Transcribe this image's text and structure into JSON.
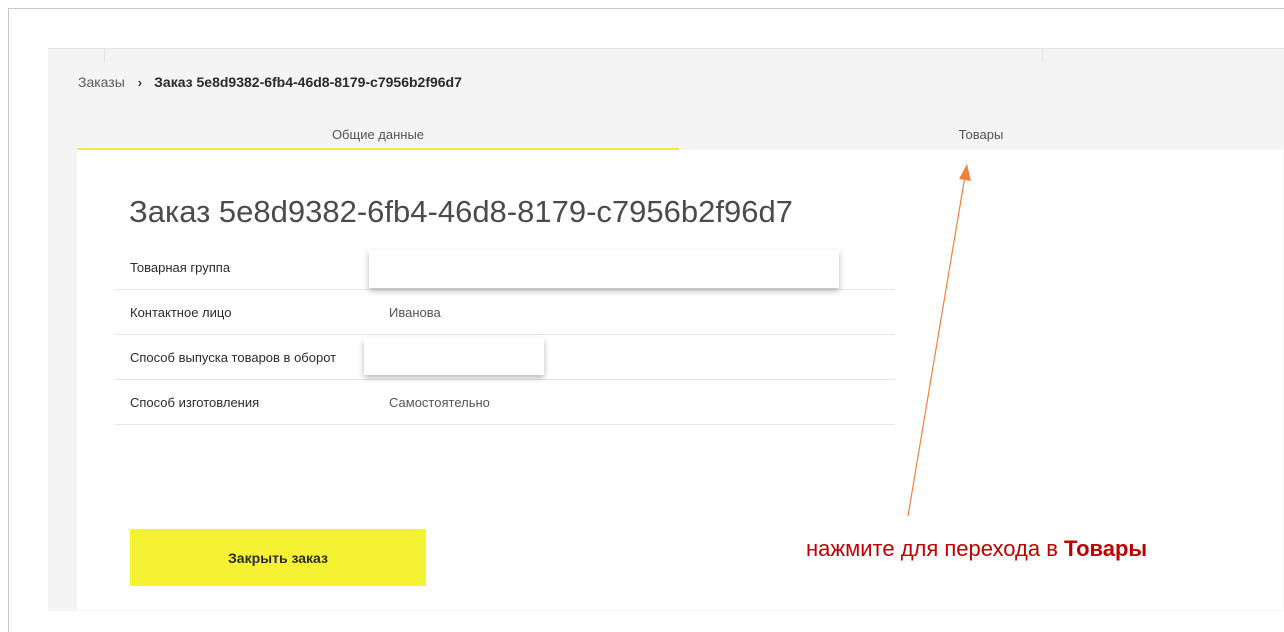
{
  "breadcrumb": {
    "parent": "Заказы",
    "separator": "›",
    "current": "Заказ 5e8d9382-6fb4-46d8-8179-c7956b2f96d7"
  },
  "tabs": [
    {
      "label": "Общие данные",
      "active": true
    },
    {
      "label": "Товары",
      "active": false
    }
  ],
  "order": {
    "title": "Заказ 5e8d9382-6fb4-46d8-8179-c7956b2f96d7",
    "fields": [
      {
        "label": "Товарная группа",
        "value": ""
      },
      {
        "label": "Контактное лицо",
        "value": "Иванова"
      },
      {
        "label": "Способ выпуска товаров в оборот",
        "value": ""
      },
      {
        "label": "Способ изготовления",
        "value": "Самостоятельно"
      }
    ],
    "close_button": "Закрыть заказ"
  },
  "annotation": {
    "text": "нажмите для перехода в ",
    "emphasis": "Товары",
    "color": "#c00000",
    "arrow_color": "#f0803c"
  },
  "colors": {
    "accent": "#f5f234",
    "tab_underline": "#f0e93a"
  }
}
